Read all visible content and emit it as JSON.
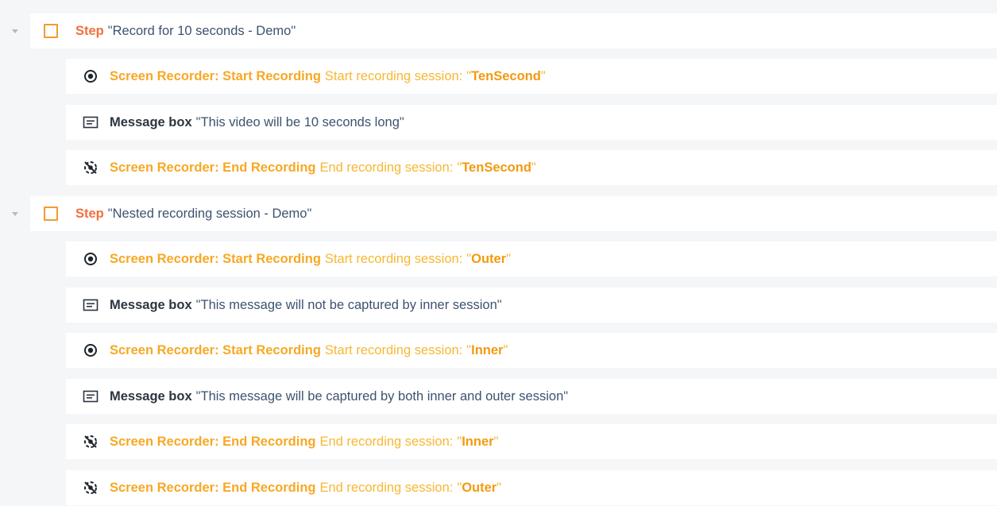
{
  "colors": {
    "step_keyword": "#f26f3e",
    "checkbox_border": "#f39a2f",
    "recorder_keyword": "#f7a823",
    "recorder_desc": "#f7b733",
    "message_keyword": "#2c3540",
    "quoted_text": "#3d5270",
    "row_background": "#ffffff",
    "page_background": "#f4f6f8"
  },
  "steps": [
    {
      "keyword": "Step",
      "title": "Record for 10 seconds - Demo",
      "actions": [
        {
          "kind": "start-recording",
          "icon": "record-icon",
          "keyword": "Screen Recorder: Start Recording",
          "description": "Start recording session:",
          "session": "TenSecond"
        },
        {
          "kind": "message-box",
          "icon": "message-box-icon",
          "keyword": "Message box",
          "text": "This video will be 10 seconds long"
        },
        {
          "kind": "end-recording",
          "icon": "end-recording-icon",
          "keyword": "Screen Recorder: End Recording",
          "description": "End recording session:",
          "session": "TenSecond"
        }
      ]
    },
    {
      "keyword": "Step",
      "title": "Nested recording session - Demo",
      "actions": [
        {
          "kind": "start-recording",
          "icon": "record-icon",
          "keyword": "Screen Recorder: Start Recording",
          "description": "Start recording session:",
          "session": "Outer"
        },
        {
          "kind": "message-box",
          "icon": "message-box-icon",
          "keyword": "Message box",
          "text": "This message will not be captured by inner session"
        },
        {
          "kind": "start-recording",
          "icon": "record-icon",
          "keyword": "Screen Recorder: Start Recording",
          "description": "Start recording session:",
          "session": "Inner"
        },
        {
          "kind": "message-box",
          "icon": "message-box-icon",
          "keyword": "Message box",
          "text": "This message will be captured by both inner and outer session"
        },
        {
          "kind": "end-recording",
          "icon": "end-recording-icon",
          "keyword": "Screen Recorder: End Recording",
          "description": "End recording session:",
          "session": "Inner"
        },
        {
          "kind": "end-recording",
          "icon": "end-recording-icon",
          "keyword": "Screen Recorder: End Recording",
          "description": "End recording session:",
          "session": "Outer"
        }
      ]
    }
  ]
}
